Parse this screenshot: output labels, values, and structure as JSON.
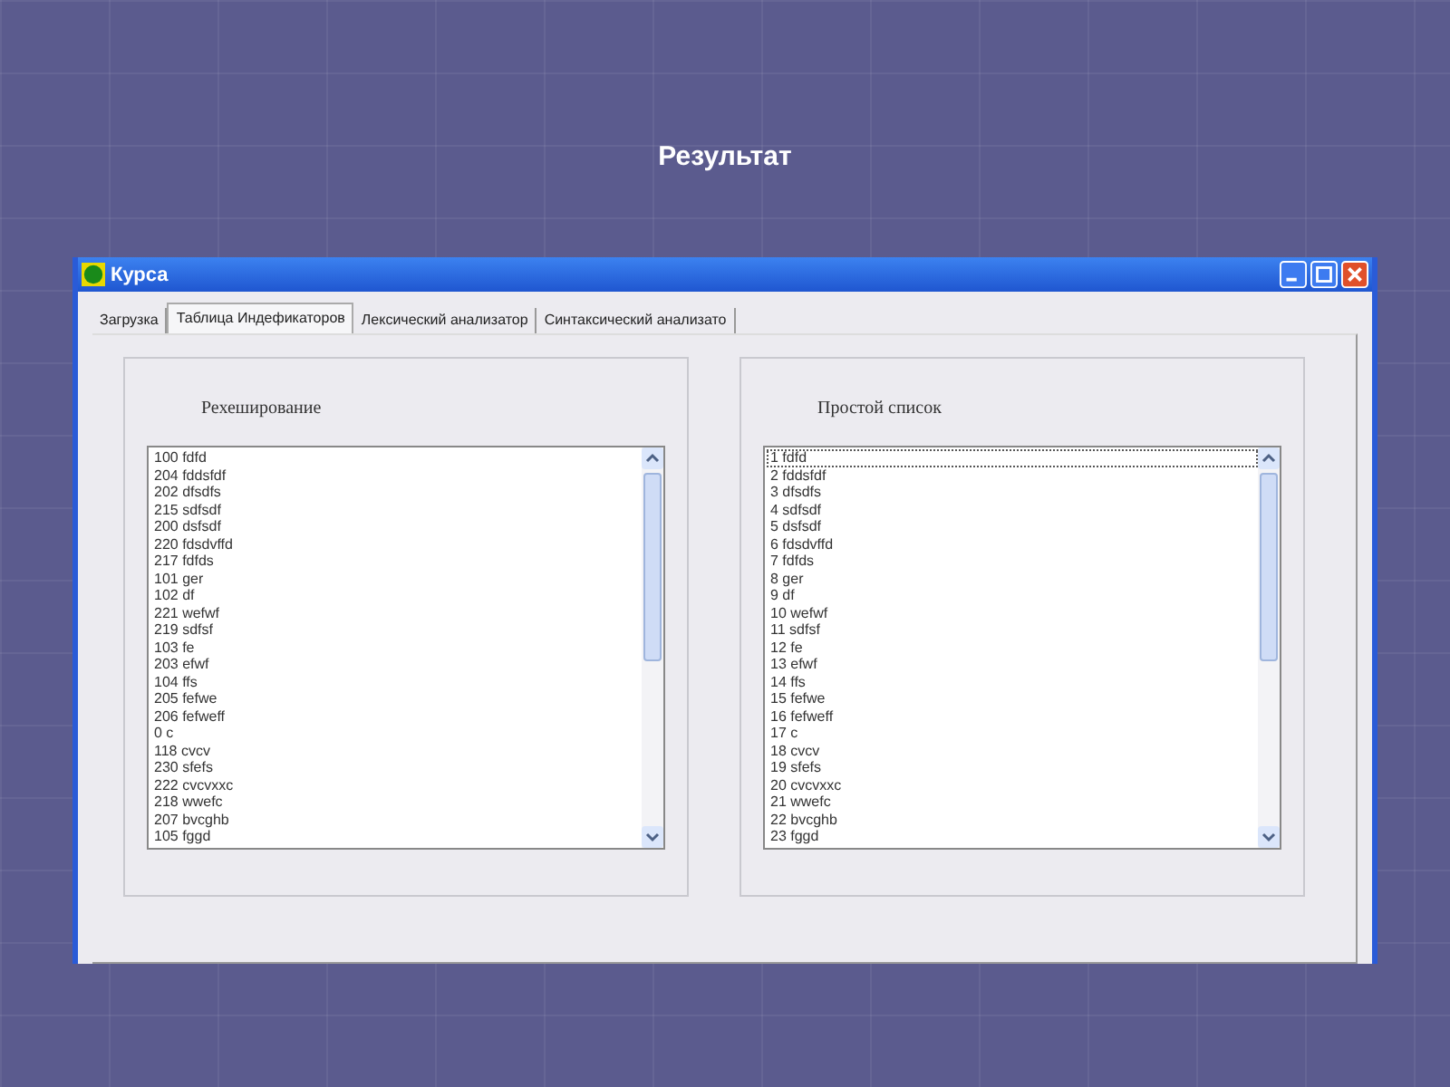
{
  "slide_title": "Результат",
  "window": {
    "title": "Курса"
  },
  "tabs": [
    {
      "label": "Загрузка",
      "selected": false
    },
    {
      "label": "Таблица Индефикаторов",
      "selected": true
    },
    {
      "label": "Лексический анализатор",
      "selected": false
    },
    {
      "label": "Синтаксический анализато",
      "selected": false
    }
  ],
  "panels": [
    {
      "title": "Рехеширование",
      "items": [
        {
          "text": "100 fdfd",
          "selected": false
        },
        {
          "text": "204 fddsfdf",
          "selected": false
        },
        {
          "text": "202 dfsdfs",
          "selected": false
        },
        {
          "text": "215 sdfsdf",
          "selected": false
        },
        {
          "text": "200 dsfsdf",
          "selected": false
        },
        {
          "text": "220 fdsdvffd",
          "selected": false
        },
        {
          "text": "217 fdfds",
          "selected": false
        },
        {
          "text": "101 ger",
          "selected": false
        },
        {
          "text": "102 df",
          "selected": false
        },
        {
          "text": "221 wefwf",
          "selected": false
        },
        {
          "text": "219 sdfsf",
          "selected": false
        },
        {
          "text": "103 fe",
          "selected": false
        },
        {
          "text": "203 efwf",
          "selected": false
        },
        {
          "text": "104 ffs",
          "selected": false
        },
        {
          "text": "205 fefwe",
          "selected": false
        },
        {
          "text": "206 fefweff",
          "selected": false
        },
        {
          "text": "0 c",
          "selected": false
        },
        {
          "text": "118 cvcv",
          "selected": false
        },
        {
          "text": "230 sfefs",
          "selected": false
        },
        {
          "text": "222 cvcvxxc",
          "selected": false
        },
        {
          "text": "218 wwefc",
          "selected": false
        },
        {
          "text": "207 bvcghb",
          "selected": false
        },
        {
          "text": "105 fggd",
          "selected": false
        }
      ]
    },
    {
      "title": "Простой список",
      "items": [
        {
          "text": "1 fdfd",
          "selected": true
        },
        {
          "text": "2 fddsfdf",
          "selected": false
        },
        {
          "text": "3 dfsdfs",
          "selected": false
        },
        {
          "text": "4 sdfsdf",
          "selected": false
        },
        {
          "text": "5 dsfsdf",
          "selected": false
        },
        {
          "text": "6 fdsdvffd",
          "selected": false
        },
        {
          "text": "7 fdfds",
          "selected": false
        },
        {
          "text": "8 ger",
          "selected": false
        },
        {
          "text": "9 df",
          "selected": false
        },
        {
          "text": "10 wefwf",
          "selected": false
        },
        {
          "text": "11 sdfsf",
          "selected": false
        },
        {
          "text": "12 fe",
          "selected": false
        },
        {
          "text": "13 efwf",
          "selected": false
        },
        {
          "text": "14 ffs",
          "selected": false
        },
        {
          "text": "15 fefwe",
          "selected": false
        },
        {
          "text": "16 fefweff",
          "selected": false
        },
        {
          "text": "17 c",
          "selected": false
        },
        {
          "text": "18 cvcv",
          "selected": false
        },
        {
          "text": "19 sfefs",
          "selected": false
        },
        {
          "text": "20 cvcvxxc",
          "selected": false
        },
        {
          "text": "21 wwefc",
          "selected": false
        },
        {
          "text": "22 bvcghb",
          "selected": false
        },
        {
          "text": "23 fggd",
          "selected": false
        }
      ]
    }
  ]
}
